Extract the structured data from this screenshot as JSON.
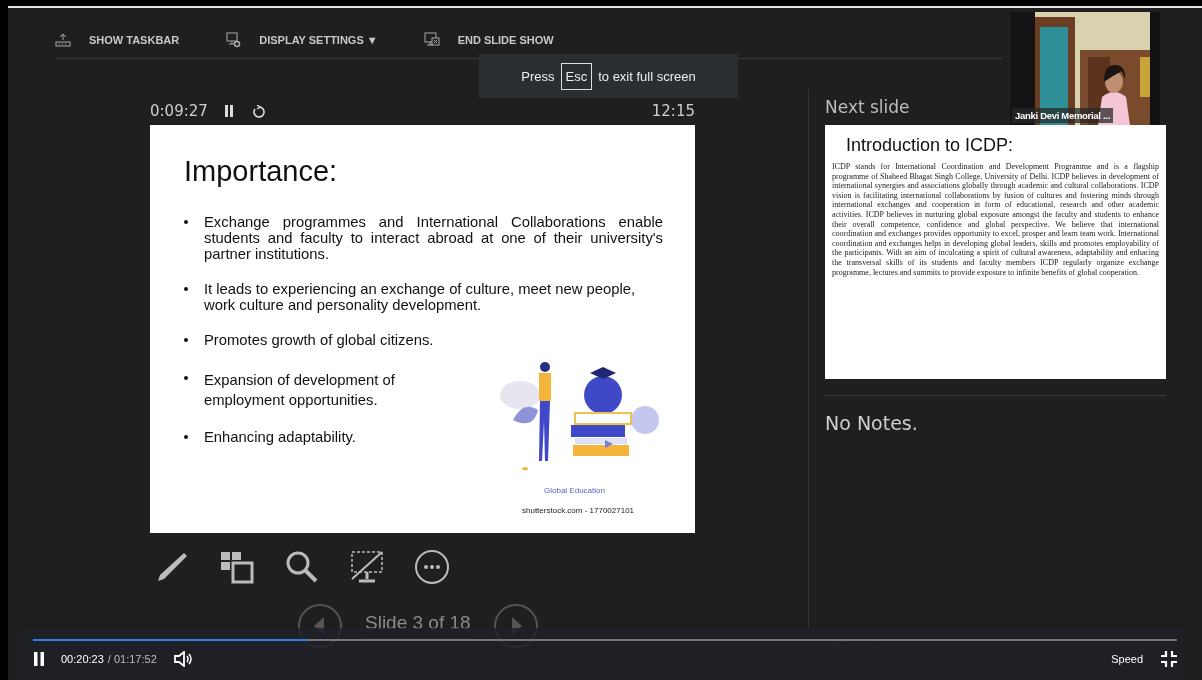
{
  "toolbar": {
    "items": [
      {
        "label": "SHOW TASKBAR",
        "kind": "taskbar"
      },
      {
        "label": "DISPLAY SETTINGS ▼",
        "kind": "display"
      },
      {
        "label": "END SLIDE SHOW",
        "kind": "end"
      }
    ]
  },
  "toast": {
    "before": "Press",
    "key": "Esc",
    "after": "to exit full screen"
  },
  "timer": {
    "elapsed": "0:09:27",
    "clock": "12:15"
  },
  "slide": {
    "title": "Importance:",
    "bullets": [
      "Exchange programmes and International Collaborations enable students and faculty to interact abroad at one of their university's partner institutions.",
      "It leads to experiencing an exchange of culture, meet new people, work culture and personality development.",
      "Promotes growth of global citizens.",
      "Expansion of development of employment opportunities.",
      "Enhancing adaptability."
    ],
    "caption": "Global Education",
    "credit": "shutterstock.com - 1770027101"
  },
  "slide_nav": {
    "label": "Slide 3 of 18"
  },
  "next_slide": {
    "heading": "Next slide",
    "title": "Introduction to ICDP:",
    "body": "ICDP stands for International Coordination and Development Programme and is a flagship programme of Shaheed Bhagat Singh College, University of Delhi. ICDP believes in development of international synergies and associations globally through academic and cultural collaborations. ICDP vision is facilitating international collaborations by fusion of cultures and fostering minds through international exchanges and cooperation in form of educational, research and other academic activities. ICDP believes in nurturing global exposure amongst the faculty and students to enhance their overall competence, confidence and global perspective. We believe that international coordination and exchanges provides opportunity to excel, prosper and learn team work. International coordination and exchanges helps in developing global leaders, skills and promotes employability of the participants. With an aim of inculcating a spirit of cultural awareness, adaptability and enhacing the transversal skills of its students and faculty members ICDP regularly organize exchange programme, lectures and summits to provide exposure to infinite benefits of global cooperation."
  },
  "notes": "No Notes.",
  "camera": {
    "name": "Janki Devi Memorial ..."
  },
  "player": {
    "level": 0.24,
    "current": "00:20:23",
    "total": "/ 01:17:52",
    "speed": "Speed"
  }
}
